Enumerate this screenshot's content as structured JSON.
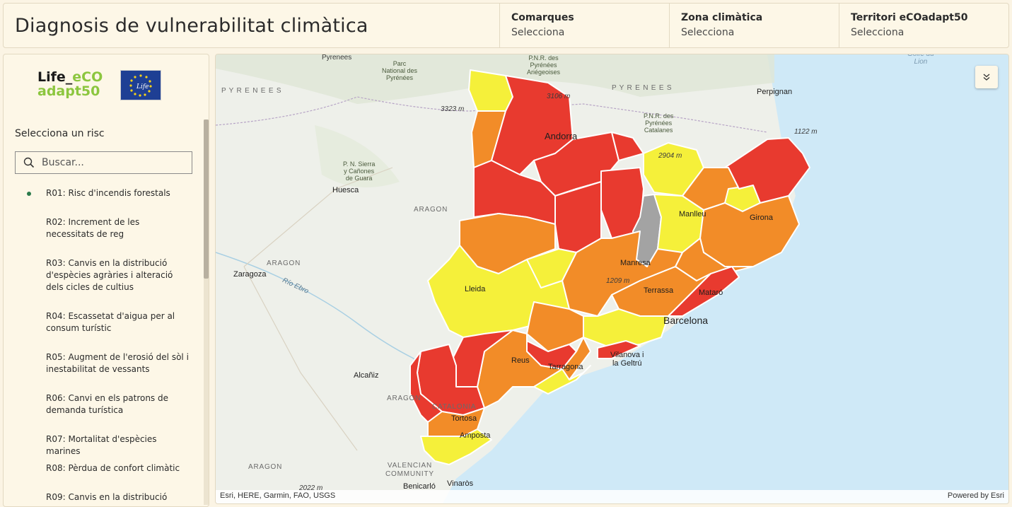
{
  "header": {
    "title": "Diagnosis de vulnerabilitat climàtica",
    "filters": [
      {
        "label": "Comarques",
        "value": "Selecciona"
      },
      {
        "label": "Zona climàtica",
        "value": "Selecciona"
      },
      {
        "label": "Territori eCOadapt50",
        "value": "Selecciona"
      }
    ]
  },
  "sidebar": {
    "logo": {
      "line1_a": "Life_",
      "line1_b": "eCO",
      "line2": "adapt50",
      "eu_text": "Life"
    },
    "select_label": "Selecciona un risc",
    "search_placeholder": "Buscar...",
    "risks": [
      {
        "label": "R01: Risc d'incendis forestals",
        "selected": true
      },
      {
        "label": "R02: Increment de les necessitats de reg",
        "selected": false
      },
      {
        "label": "R03: Canvis en la distribució d'espècies agràries i alteració dels cicles de cultius",
        "selected": false
      },
      {
        "label": "R04: Escassetat d'aigua per al consum turístic",
        "selected": false
      },
      {
        "label": "R05: Augment de l'erosió del sòl i inestabilitat de vessants",
        "selected": false
      },
      {
        "label": "R06: Canvi en els patrons de demanda turística",
        "selected": false
      },
      {
        "label": "R07: Mortalitat d'espècies marines",
        "selected": false
      },
      {
        "label": "R08: Pèrdua de confort climàtic",
        "selected": false
      },
      {
        "label": "R09: Canvis en la distribució",
        "selected": false
      }
    ]
  },
  "map": {
    "colors": {
      "high": "#e83a2f",
      "mid": "#f28c28",
      "low": "#f5f03a",
      "nodata": "#a3a3a3",
      "sea": "#cfe9f7",
      "land": "#eef0ea"
    },
    "labels": {
      "pyrenees_top": "Pyrenees",
      "pyrenees_left": "P Y R E N E E S",
      "pyrenees_right": "P Y R E N E E S",
      "parc_nacional": "Parc\nNational des\nPyrénées",
      "pnr_ariegeoises": "P.N.R. des\nPyrénées\nAriégeoises",
      "pnr_catalanes": "P.N.R. des\nPyrénées\nCatalanes",
      "pn_sierra": "P. N. Sierra\ny Cañones\nde Guara",
      "elev_3323": "3323 m",
      "elev_3106": "3106 m",
      "elev_2904": "2904 m",
      "elev_1122": "1122 m",
      "elev_1209": "1209 m",
      "elev_2022": "2022 m",
      "perpignan": "Perpignan",
      "golfe": "Golfe du\nLion",
      "andorra": "Andorra",
      "huesca": "Huesca",
      "aragon1": "ARAGON",
      "aragon2": "ARAGON",
      "aragon3": "ARAGON",
      "aragon4": "ARAGON",
      "zaragoza": "Zaragoza",
      "rio_ebro": "Río Ebro",
      "lleida": "Lleida",
      "manlleu": "Manlleu",
      "girona": "Girona",
      "manresa": "Manresa",
      "terrassa": "Terrassa",
      "mataro": "Mataró",
      "barcelona": "Barcelona",
      "vilanova": "Vilanova i\nla Geltrú",
      "reus": "Reus",
      "tarragona": "Tarragona",
      "alcaniz": "Alcañiz",
      "tortosa": "Tortosa",
      "amposta": "Amposta",
      "catalonia": "CATALONIA",
      "valencian": "VALENCIAN\nCOMMUNITY",
      "benicarlo": "Benicarló",
      "vinaros": "Vinaròs"
    },
    "attribution_left": "Esri, HERE, Garmin, FAO, USGS",
    "attribution_right": "Powered by Esri"
  }
}
